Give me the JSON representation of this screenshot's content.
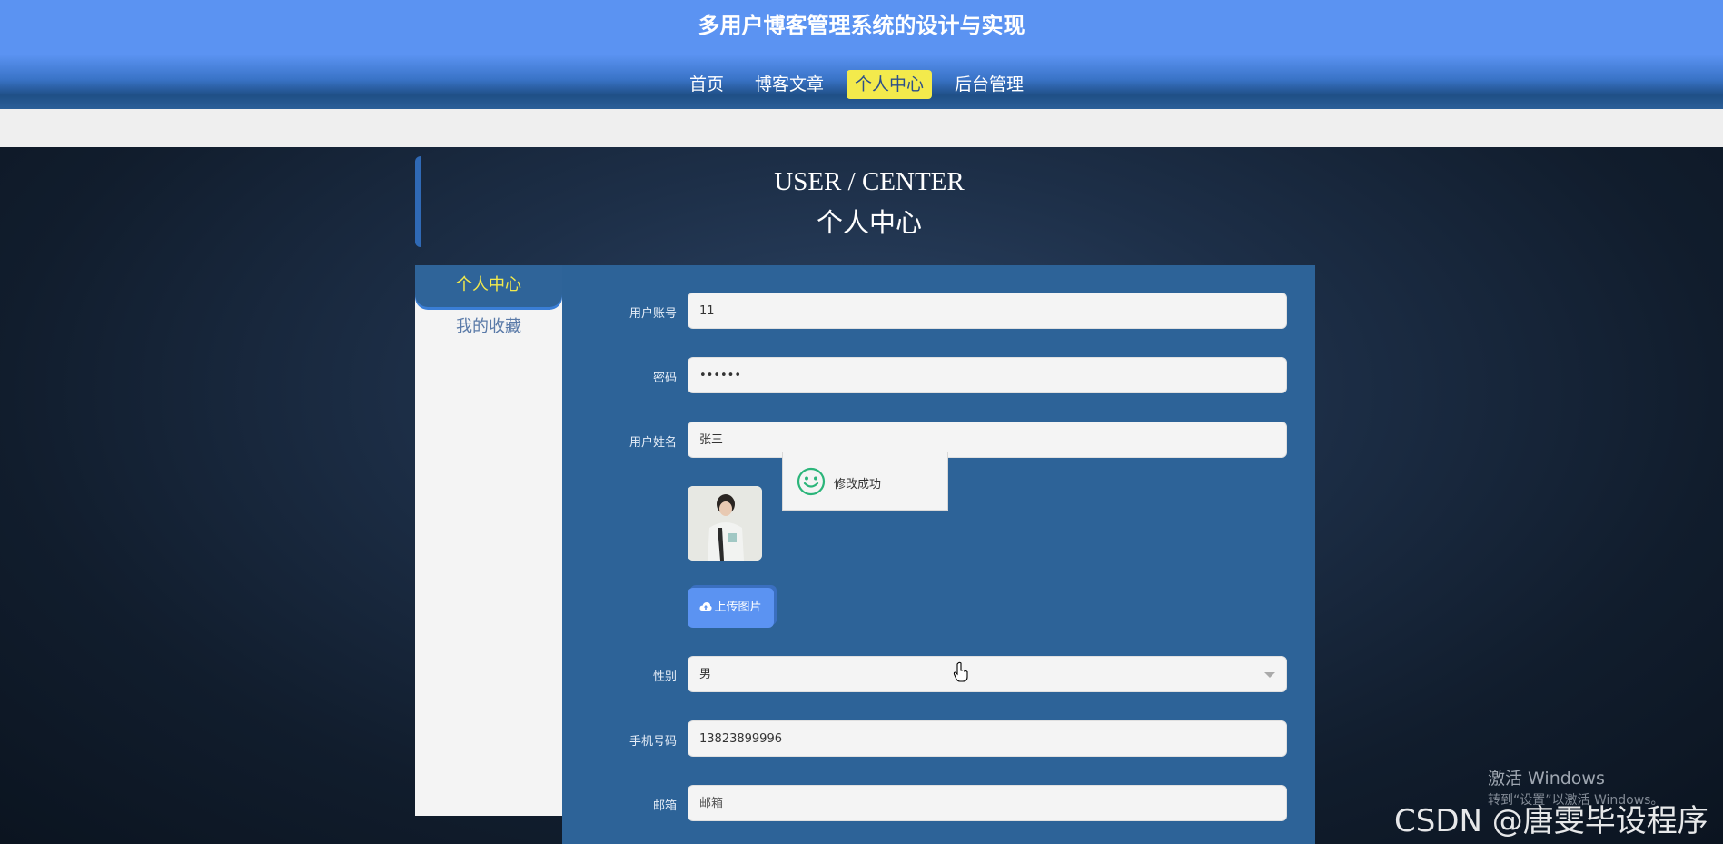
{
  "header": {
    "site_title": "多用户博客管理系统的设计与实现",
    "nav": [
      {
        "label": "首页"
      },
      {
        "label": "博客文章"
      },
      {
        "label": "个人中心",
        "active": true
      },
      {
        "label": "后台管理"
      }
    ]
  },
  "page_heading": {
    "en": "USER / CENTER",
    "cn": "个人中心"
  },
  "sidebar": {
    "items": [
      {
        "label": "个人中心",
        "active": true
      },
      {
        "label": "我的收藏"
      }
    ]
  },
  "form": {
    "account": {
      "label": "用户账号",
      "value": "11"
    },
    "password": {
      "label": "密码",
      "value": "••••••"
    },
    "name": {
      "label": "用户姓名",
      "value": "张三"
    },
    "upload_label": "上传图片",
    "gender": {
      "label": "性别",
      "value": "男"
    },
    "phone": {
      "label": "手机号码",
      "value": "13823899996"
    },
    "email": {
      "label": "邮箱",
      "placeholder": "邮箱"
    }
  },
  "toast": {
    "message": "修改成功",
    "icon": "smile-icon"
  },
  "watermarks": {
    "windows_title": "激活 Windows",
    "windows_sub": "转到“设置”以激活 Windows。",
    "csdn": "CSDN @唐雯毕设程序"
  },
  "colors": {
    "topbar": "#5b93f2",
    "nav_active_bg": "#f3ea4c",
    "panel": "#2d6398",
    "sidebar_active_text": "#f3ea4c"
  }
}
